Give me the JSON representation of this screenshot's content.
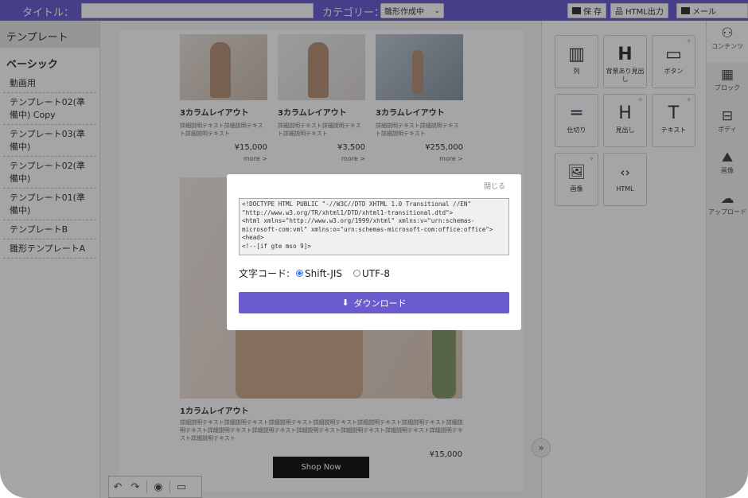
{
  "topbar": {
    "title_label": "タイトル：",
    "category_label": "カテゴリー：",
    "category_value": "雛形作成中",
    "save_label": "保 存",
    "html_export_label": "HTML出力",
    "mail_label": "メール"
  },
  "left_panel": {
    "header": "テンプレート",
    "section": "ベーシック",
    "items": [
      "動画用",
      "テンプレート02(準備中) Copy",
      "テンプレート03(準備中)",
      "テンプレート02(準備中)",
      "テンプレート01(準備中)",
      "テンプレートB",
      "雛形テンプレートA"
    ]
  },
  "canvas": {
    "products": [
      {
        "title": "3カラムレイアウト",
        "desc": "詳細説明テキスト詳細説明テキスト詳細説明テキスト",
        "price": "¥15,000",
        "more": "more >"
      },
      {
        "title": "3カラムレイアウト",
        "desc": "詳細説明テキスト詳細説明テキスト詳細説明テキスト",
        "price": "¥3,500",
        "more": "more >"
      },
      {
        "title": "3カラムレイアウト",
        "desc": "詳細説明テキスト詳細説明テキスト詳細説明テキスト",
        "price": "¥255,000",
        "more": "more >"
      }
    ],
    "single": {
      "title": "1カラムレイアウト",
      "desc": "詳細説明テキスト詳細説明テキスト詳細説明テキスト詳細説明テキスト詳細説明テキスト詳細説明テキスト詳細説明テキスト詳細説明テキスト詳細説明テキスト詳細説明テキスト詳細説明テキスト詳細説明テキスト詳細説明テキスト詳細説明テキスト",
      "price": "¥15,000"
    },
    "shop_now": "Shop Now"
  },
  "blocks": [
    {
      "label": "列",
      "glyph": "▥"
    },
    {
      "label": "背景あり見出し",
      "glyph": "H"
    },
    {
      "label": "ボタン",
      "glyph": "▭"
    },
    {
      "label": "仕切り",
      "glyph": "═"
    },
    {
      "label": "見出し",
      "glyph": "H"
    },
    {
      "label": "テキスト",
      "glyph": "T"
    },
    {
      "label": "画像",
      "glyph": "🖼"
    },
    {
      "label": "HTML",
      "glyph": "‹›"
    }
  ],
  "sidebar": [
    {
      "label": "コンテンツ",
      "icon": "shapes-icon"
    },
    {
      "label": "ブロック",
      "icon": "block-icon"
    },
    {
      "label": "ボディ",
      "icon": "body-icon"
    },
    {
      "label": "画像",
      "icon": "image-icon"
    },
    {
      "label": "アップロード",
      "icon": "upload-icon"
    }
  ],
  "modal": {
    "close": "閉じる",
    "code": "<!DOCTYPE HTML PUBLIC \"-//W3C//DTD XHTML 1.0 Transitional //EN\"\n\"http://www.w3.org/TR/xhtml1/DTD/xhtml1-transitional.dtd\">\n<html xmlns=\"http://www.w3.org/1999/xhtml\" xmlns:v=\"urn:schemas-microsoft-com:vml\" xmlns:o=\"urn:schemas-microsoft-com:office:office\">\n<head>\n<!--[if gte mso 9]>",
    "encoding_label": "文字コード:",
    "enc_shiftjis": "Shift-JIS",
    "enc_utf8": "UTF-8",
    "selected_encoding": "Shift-JIS",
    "download": "ダウンロード"
  },
  "colors": {
    "accent": "#5850c8",
    "button": "#6a5ccf"
  }
}
